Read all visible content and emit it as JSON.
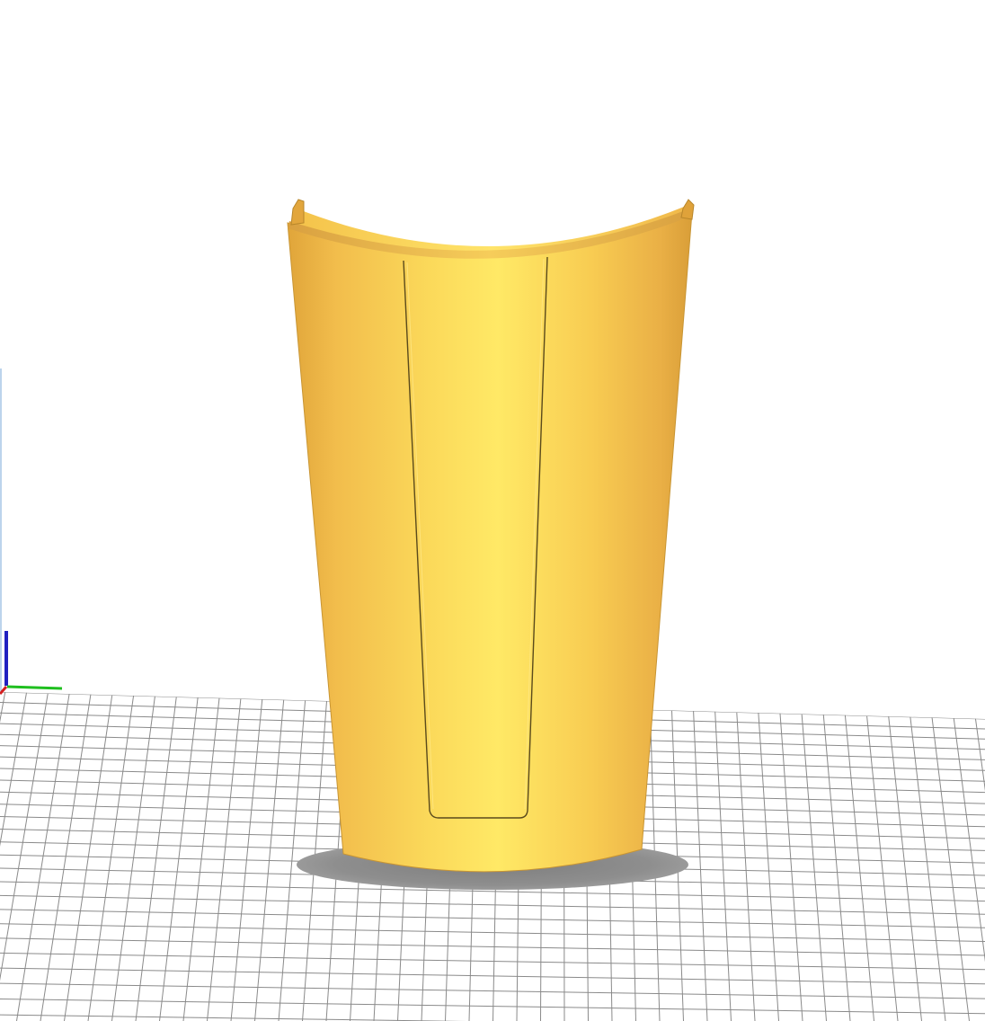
{
  "viewport": {
    "background_color": "#ffffff",
    "build_plate": {
      "surface_color": "#ffffff",
      "grid_line_color": "#8a8a8a",
      "grid": "on"
    },
    "axes": {
      "x_axis_color": "#d42020",
      "y_axis_color": "#1fbf1f",
      "z_axis_color": "#2020c0",
      "z_guide_color": "#7aa8d8"
    },
    "model": {
      "shape": "curved-shell-bracer",
      "fill_color": "#f5c54a",
      "highlight_color": "#fff06a",
      "edge_color": "#b98d1e",
      "panel_outline_color": "#5a4a1c",
      "shadow_color": "#8c8c8c"
    }
  }
}
